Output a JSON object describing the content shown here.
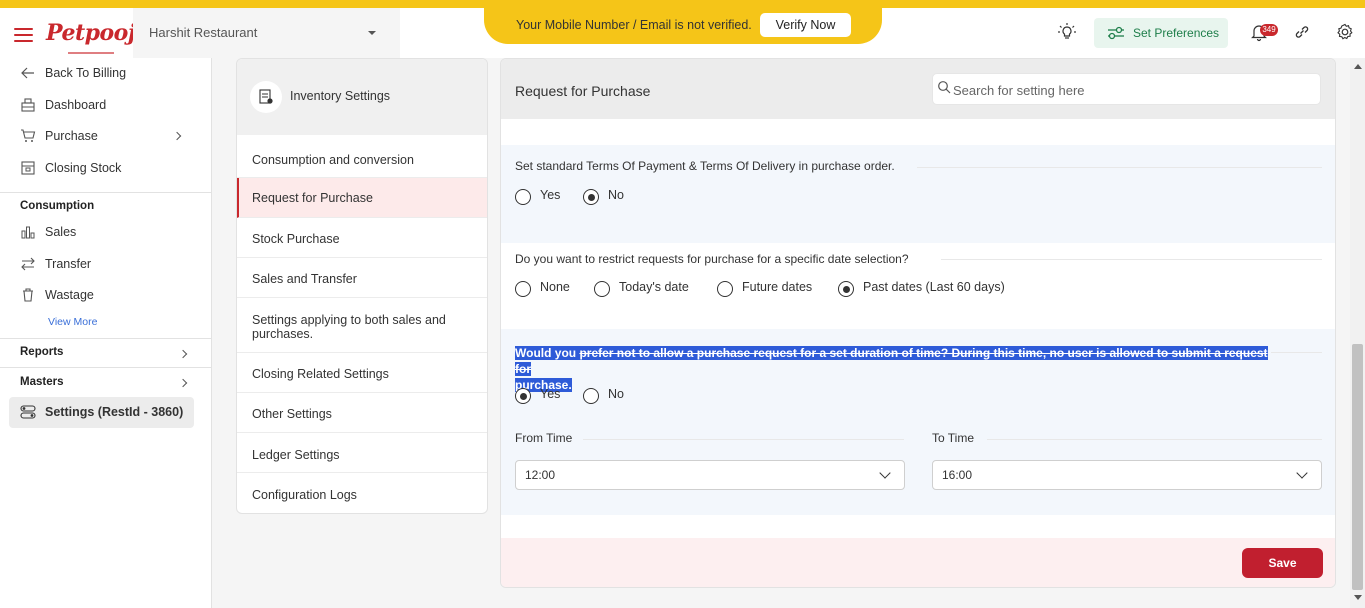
{
  "header": {
    "logo": "Petpooja",
    "restaurant": "Harshit Restaurant",
    "verify_message": "Your Mobile Number / Email is not verified.",
    "verify_button": "Verify Now",
    "set_preferences": "Set Preferences",
    "notification_count": "349",
    "brand_color": "#c9282d",
    "banner_color": "#f5c518"
  },
  "sidebar": {
    "top_items": [
      {
        "label": "Back To Billing",
        "icon": "arrow-left-icon"
      },
      {
        "label": "Dashboard",
        "icon": "dashboard-icon"
      },
      {
        "label": "Purchase",
        "icon": "cart-icon"
      },
      {
        "label": "Closing Stock",
        "icon": "closing-stock-icon"
      }
    ],
    "consumption_title": "Consumption",
    "consumption_items": [
      {
        "label": "Sales",
        "icon": "chart-icon"
      },
      {
        "label": "Transfer",
        "icon": "transfer-icon"
      },
      {
        "label": "Wastage",
        "icon": "trash-icon"
      }
    ],
    "view_more": "View More",
    "reports": "Reports",
    "masters": "Masters",
    "settings": "Settings (RestId - 3860)"
  },
  "inventory": {
    "title": "Inventory Settings",
    "items": [
      "Consumption and conversion",
      "Request for Purchase",
      "Stock Purchase",
      "Sales and Transfer",
      "Settings applying to both sales and purchases.",
      "Closing Related Settings",
      "Other Settings",
      "Ledger Settings",
      "Configuration Logs"
    ],
    "active_index": 1
  },
  "main": {
    "title": "Request for Purchase",
    "search_placeholder": "Search for setting here",
    "q1": {
      "text": "Set standard Terms Of Payment & Terms Of Delivery in purchase order.",
      "options": [
        "Yes",
        "No"
      ],
      "selected": "No"
    },
    "q2": {
      "text": "Do you want to restrict requests for purchase for a specific date selection?",
      "options": [
        "None",
        "Today's date",
        "Future dates",
        "Past dates (Last 60 days)"
      ],
      "selected": "Past dates (Last 60 days)"
    },
    "q3": {
      "text_a": "Would you ",
      "text_b": "prefer not to allow a purchase request for a set duration of time? During this time, no user is allowed to submit a request for",
      "text_c": "purchase.",
      "options": [
        "Yes",
        "No"
      ],
      "selected": "Yes",
      "from_label": "From Time",
      "from_value": "12:00",
      "to_label": "To Time",
      "to_value": "16:00"
    },
    "save": "Save"
  }
}
